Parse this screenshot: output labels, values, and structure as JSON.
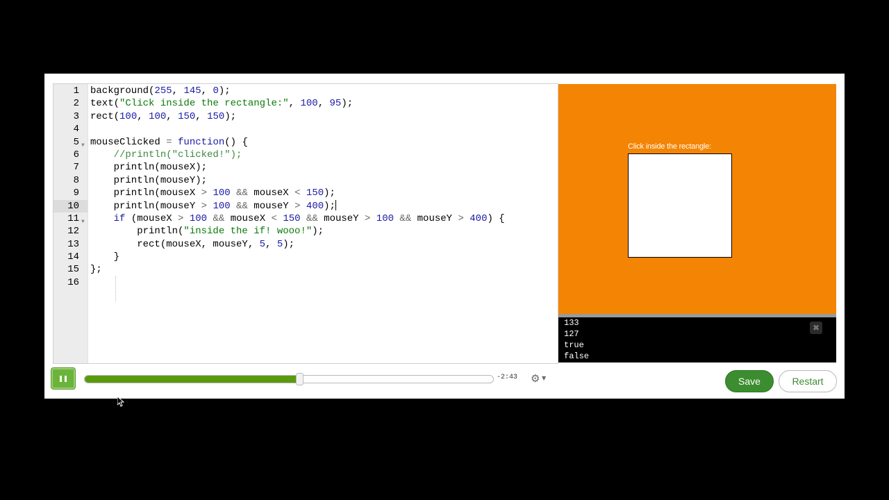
{
  "editor": {
    "lines": [
      {
        "n": "1",
        "html": "background(<span class=\"num\">255</span>, <span class=\"num\">145</span>, <span class=\"num\">0</span>);"
      },
      {
        "n": "2",
        "html": "text(<span class=\"str\">\"Click inside the rectangle:\"</span>, <span class=\"num\">100</span>, <span class=\"num\">95</span>);"
      },
      {
        "n": "3",
        "html": "rect(<span class=\"num\">100</span>, <span class=\"num\">100</span>, <span class=\"num\">150</span>, <span class=\"num\">150</span>);"
      },
      {
        "n": "4",
        "html": ""
      },
      {
        "n": "5",
        "fold": true,
        "html": "mouseClicked <span class=\"op\">=</span> <span class=\"kw\">function</span>() {"
      },
      {
        "n": "6",
        "html": "    <span class=\"cmt\">//println(\"clicked!\");</span>"
      },
      {
        "n": "7",
        "html": "    println(mouseX);"
      },
      {
        "n": "8",
        "html": "    println(mouseY);"
      },
      {
        "n": "9",
        "html": "    println(mouseX <span class=\"op\">&gt;</span> <span class=\"num\">100</span> <span class=\"op\">&amp;&amp;</span> mouseX <span class=\"op\">&lt;</span> <span class=\"num\">150</span>);"
      },
      {
        "n": "10",
        "active": true,
        "html": "    println(mouseY <span class=\"op\">&gt;</span> <span class=\"num\">100</span> <span class=\"op\">&amp;&amp;</span> mouseY <span class=\"op\">&gt;</span> <span class=\"num\">400</span>);<span class=\"cursor\"></span>"
      },
      {
        "n": "11",
        "fold": true,
        "html": "    <span class=\"kw\">if</span> (mouseX <span class=\"op\">&gt;</span> <span class=\"num\">100</span> <span class=\"op\">&amp;&amp;</span> mouseX <span class=\"op\">&lt;</span> <span class=\"num\">150</span> <span class=\"op\">&amp;&amp;</span> mouseY <span class=\"op\">&gt;</span> <span class=\"num\">100</span> <span class=\"op\">&amp;&amp;</span> mouseY <span class=\"op\">&gt;</span> <span class=\"num\">400</span>) {"
      },
      {
        "n": "12",
        "html": "        println(<span class=\"str\">\"inside the if! wooo!\"</span>);"
      },
      {
        "n": "13",
        "html": "        rect(mouseX, mouseY, <span class=\"num\">5</span>, <span class=\"num\">5</span>);"
      },
      {
        "n": "14",
        "html": "    }"
      },
      {
        "n": "15",
        "html": "};"
      },
      {
        "n": "16",
        "html": ""
      }
    ]
  },
  "canvas": {
    "background": "#f48403",
    "text": "Click inside the rectangle:"
  },
  "console": {
    "lines": [
      "133",
      "127",
      "true",
      "false"
    ],
    "close_icon": "close-icon"
  },
  "player": {
    "progress": 0.525,
    "time_remaining": "-2:43",
    "settings_icon": "gear-icon"
  },
  "buttons": {
    "save_label": "Save",
    "restart_label": "Restart"
  }
}
